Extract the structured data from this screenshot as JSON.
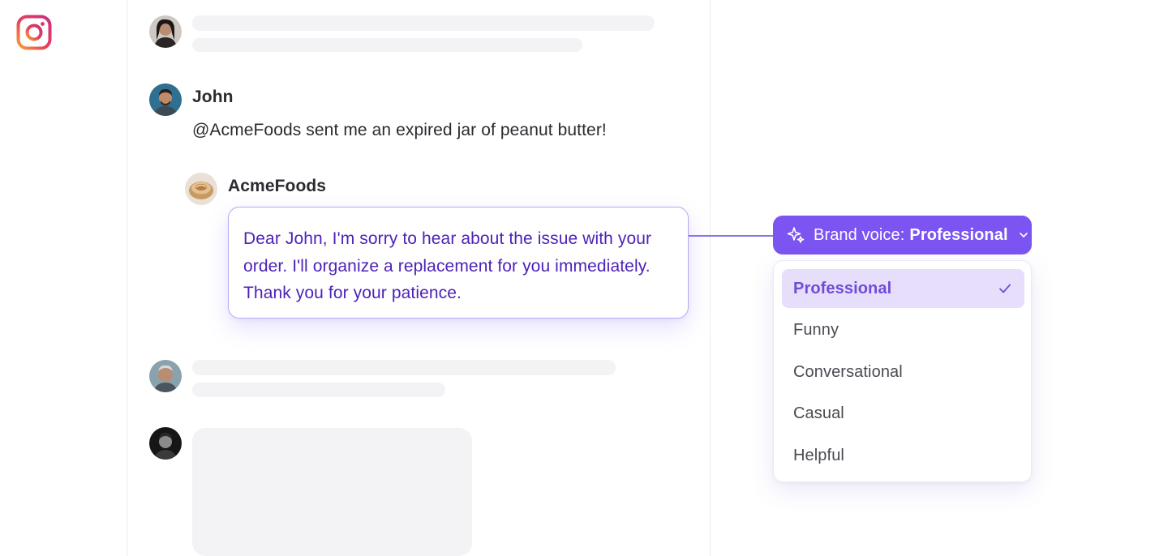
{
  "app": {
    "icon": "instagram-icon"
  },
  "comments": [
    {
      "author": "",
      "text": ""
    },
    {
      "author": "John",
      "text": "@AcmeFoods sent me an expired jar of peanut butter!"
    },
    {
      "author": "",
      "text": ""
    },
    {
      "author": "",
      "text": ""
    }
  ],
  "reply": {
    "author": "AcmeFoods",
    "text": "Dear John, I'm sorry to hear about the issue with your order. I'll organize a replacement for you immediately. Thank you for your patience."
  },
  "brand_voice": {
    "label": "Brand voice:",
    "value": "Professional",
    "icon": "sparkle-icon",
    "options": [
      {
        "label": "Professional",
        "selected": true
      },
      {
        "label": "Funny",
        "selected": false
      },
      {
        "label": "Conversational",
        "selected": false
      },
      {
        "label": "Casual",
        "selected": false
      },
      {
        "label": "Helpful",
        "selected": false
      }
    ]
  },
  "colors": {
    "accent": "#7b54f2",
    "reply_text": "#4d22b8",
    "selected_bg": "#e6defb",
    "selected_text": "#6f4bd8"
  }
}
